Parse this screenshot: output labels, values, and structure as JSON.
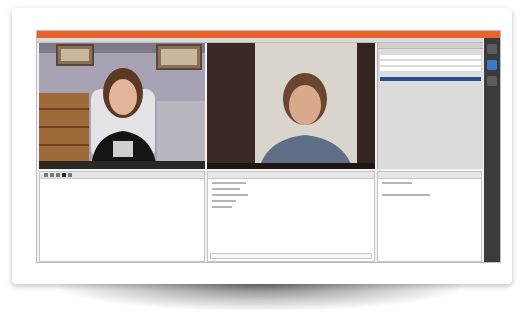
{
  "app": {
    "accent_color": "#e8642a",
    "menu_items": [
      "",
      "",
      "",
      "",
      "",
      ""
    ]
  },
  "videos": {
    "left_caption": "",
    "right_caption": ""
  },
  "side_panel": {
    "items": [
      "",
      "",
      "",
      ""
    ],
    "selected_index": 3
  },
  "chat": {
    "lines": [
      "",
      "",
      "",
      "",
      ""
    ]
  },
  "notes": {
    "lines": [
      "",
      ""
    ]
  },
  "icons": [
    "pencil-icon",
    "eraser-icon",
    "shape-icon",
    "color-icon",
    "text-icon"
  ]
}
